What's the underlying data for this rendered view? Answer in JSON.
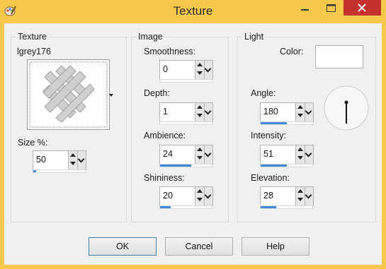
{
  "window": {
    "title": "Texture"
  },
  "texture_group": {
    "label": "Texture",
    "name": "lgrey176",
    "size_label": "Size %:",
    "size": {
      "value": "50",
      "level": 0.05
    }
  },
  "image_group": {
    "label": "Image",
    "smoothness": {
      "label": "Smoothness:",
      "value": "0",
      "level": 0.0
    },
    "depth": {
      "label": "Depth:",
      "value": "1",
      "level": 0.0
    },
    "ambience": {
      "label": "Ambience:",
      "value": "24",
      "level": 0.6
    },
    "shininess": {
      "label": "Shininess:",
      "value": "20",
      "level": 0.2
    }
  },
  "light_group": {
    "label": "Light",
    "color_label": "Color:",
    "color": "#ffffff",
    "angle": {
      "label": "Angle:",
      "value": "180",
      "level": 0.5
    },
    "intensity": {
      "label": "Intensity:",
      "value": "51",
      "level": 0.5
    },
    "elevation": {
      "label": "Elevation:",
      "value": "28",
      "level": 0.3
    }
  },
  "buttons": {
    "ok": "OK",
    "cancel": "Cancel",
    "help": "Help"
  },
  "colors": {
    "titlebar": "#f7c94a",
    "close": "#c7312d",
    "accent": "#3f8ad8"
  },
  "icons": {
    "app": "paint-palette-icon",
    "minimize": "minimize-icon",
    "maximize": "maximize-icon",
    "close": "close-icon"
  }
}
